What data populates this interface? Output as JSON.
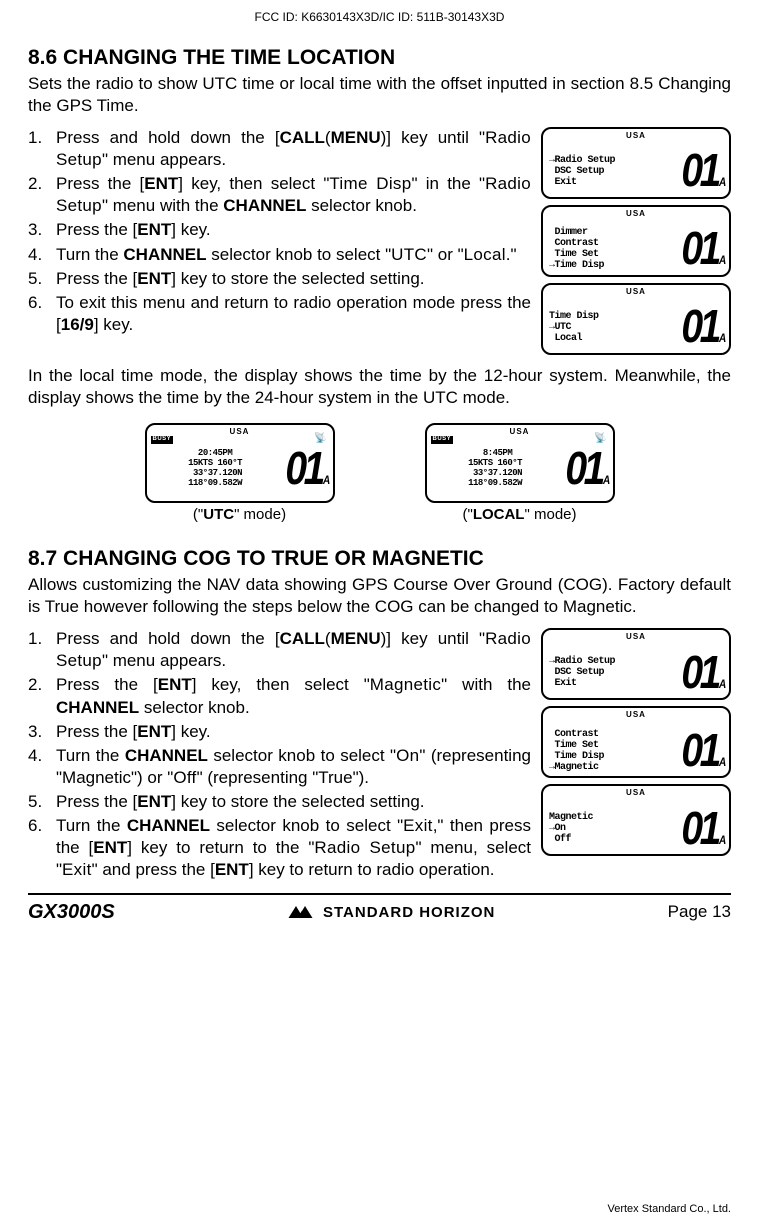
{
  "fcc": "FCC ID: K6630143X3D/IC ID: 511B-30143X3D",
  "sec86": {
    "title": "8.6  CHANGING THE TIME LOCATION",
    "intro": "Sets the radio to show UTC time or local time with the offset inputted in section 8.5 Changing the GPS Time.",
    "steps": [
      {
        "n": "1.",
        "pre": "Press and hold down the [",
        "b1": "CALL",
        "mid1": "(",
        "b2": "MENU",
        "mid2": ")] key until \"",
        "sc": "Radio Setup",
        "post": "\" menu appears."
      },
      {
        "n": "2.",
        "raw": "Press the [<b>ENT</b>] key, then select \"<span class='scaps'>Time Disp</span>\" in the \"<span class='scaps'>Radio Setup</span>\" menu with the <b>CHANNEL</b> selector knob."
      },
      {
        "n": "3.",
        "raw": "Press the [<b>ENT</b>] key."
      },
      {
        "n": "4.",
        "raw": "Turn the <b>CHANNEL</b> selector knob to select \"<span class='scaps'>UTC</span>\" or \"<span class='scaps'>Local</span>.\""
      },
      {
        "n": "5.",
        "raw": "Press the [<b>ENT</b>] key to store  the selected setting."
      },
      {
        "n": "6.",
        "raw": "To exit this menu and return to radio operation mode press the [<b>16/9</b>] key."
      }
    ],
    "lcd": [
      {
        "usa": "USA",
        "lines": "→Radio Setup\n DSC Setup\n Exit",
        "ch": "01",
        "sub": "A"
      },
      {
        "usa": "USA",
        "lines": " Dimmer\n Contrast\n Time Set\n→Time Disp",
        "ch": "01",
        "sub": "A"
      },
      {
        "usa": "USA",
        "lines": "Time Disp\n→UTC\n Local",
        "ch": "01",
        "sub": "A"
      }
    ],
    "post": "In the local time mode, the display shows the time by the 12-hour system. Meanwhile, the display shows the time by the 24-hour system in the UTC mode.",
    "modes": [
      {
        "busy": "BUSY",
        "usa": "USA",
        "lines": "20:45PM\n15KTS 160°T\n 33°37.120N\n118°09.582W",
        "ch": "01",
        "sub": "A",
        "label_pre": "(\"",
        "label_b": "UTC",
        "label_post": "\" mode)"
      },
      {
        "busy": "BUSY",
        "usa": "USA",
        "lines": " 8:45PM\n15KTS 160°T\n 33°37.120N\n118°09.582W",
        "ch": "01",
        "sub": "A",
        "label_pre": "(\"",
        "label_b": "LOCAL",
        "label_post": "\" mode)"
      }
    ]
  },
  "sec87": {
    "title": "8.7  CHANGING COG TO TRUE OR MAGNETIC",
    "intro": "Allows customizing the NAV data showing GPS Course Over Ground (COG). Factory default is True however following the steps below the COG can be changed to Magnetic.",
    "steps": [
      {
        "n": "1.",
        "raw": "Press and hold down the [<b>CALL</b>(<b>MENU</b>)] key until \"<span class='scaps'>Radio Setup</span>\" menu appears."
      },
      {
        "n": "2.",
        "raw": "Press the [<b>ENT</b>] key, then select \"<span class='scaps'>Magnetic</span>\" with the <b>CHANNEL</b> selector knob."
      },
      {
        "n": "3.",
        "raw": "Press the [<b>ENT</b>] key."
      },
      {
        "n": "4.",
        "raw": "Turn the <b>CHANNEL</b> selector knob to select \"<span class='scaps'>On</span>\" (representing \"Magnetic\") or \"<span class='scaps'>Off</span>\" (representing \"True\")."
      },
      {
        "n": "5.",
        "raw": "Press the [<b>ENT</b>] key to store the selected setting."
      },
      {
        "n": "6.",
        "raw": "Turn the <b>CHANNEL</b> selector knob to select \"<span class='scaps'>Exit</span>,\" then press the [<b>ENT</b>] key to return to the \"<span class='scaps'>Radio Setup</span>\" menu, select \"<span class='scaps'>Exit</span>\" and press the [<b>ENT</b>] key to return to radio operation."
      }
    ],
    "lcd": [
      {
        "usa": "USA",
        "lines": "→Radio Setup\n DSC Setup\n Exit",
        "ch": "01",
        "sub": "A"
      },
      {
        "usa": "USA",
        "lines": " Contrast\n Time Set\n Time Disp\n→Magnetic",
        "ch": "01",
        "sub": "A"
      },
      {
        "usa": "USA",
        "lines": "Magnetic\n→On\n Off",
        "ch": "01",
        "sub": "A"
      }
    ]
  },
  "footer": {
    "model": "GX3000S",
    "brand": "STANDARD HORIZON",
    "page": "Page 13",
    "vertex": "Vertex Standard Co., Ltd."
  }
}
